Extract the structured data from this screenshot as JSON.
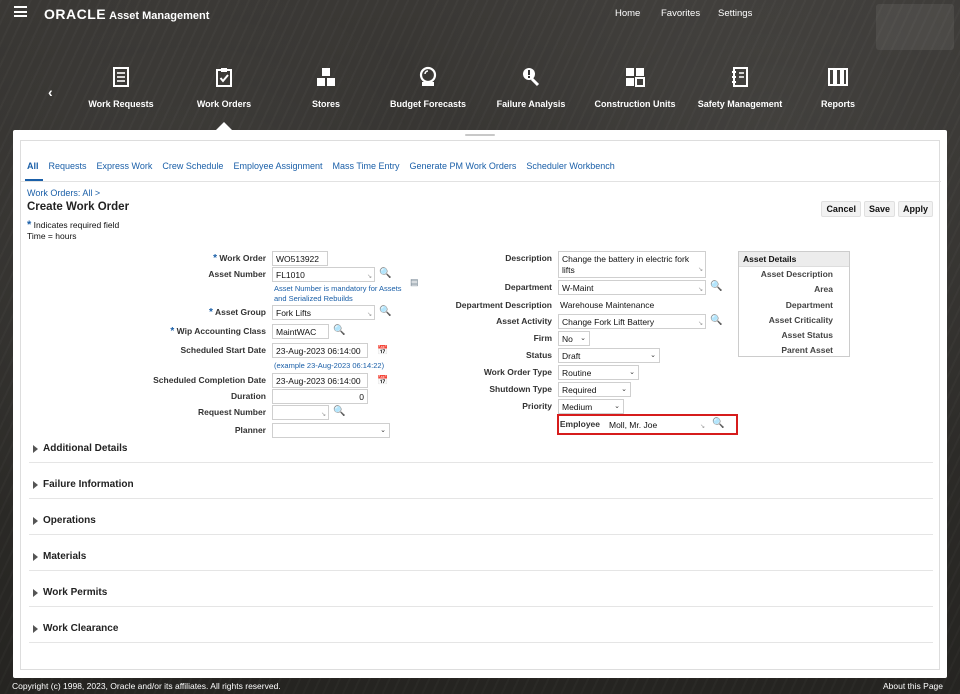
{
  "header": {
    "brand": "ORACLE",
    "app_name": "Asset Management",
    "links": [
      "Home",
      "Favorites",
      "Settings"
    ]
  },
  "nav": {
    "items": [
      {
        "label": "Work Requests",
        "icon": "document-list-icon"
      },
      {
        "label": "Work Orders",
        "icon": "clipboard-check-icon"
      },
      {
        "label": "Stores",
        "icon": "boxes-icon"
      },
      {
        "label": "Budget Forecasts",
        "icon": "crystal-ball-icon"
      },
      {
        "label": "Failure Analysis",
        "icon": "wrench-alert-icon"
      },
      {
        "label": "Construction Units",
        "icon": "puzzle-icon"
      },
      {
        "label": "Safety Management",
        "icon": "binder-icon"
      },
      {
        "label": "Reports",
        "icon": "columns-icon"
      }
    ],
    "active": "Work Orders"
  },
  "tabs": [
    "All",
    "Requests",
    "Express Work",
    "Crew Schedule",
    "Employee Assignment",
    "Mass Time Entry",
    "Generate PM Work Orders",
    "Scheduler Workbench"
  ],
  "breadcrumb": "Work Orders: All  >",
  "page_title": "Create Work Order",
  "required_note": "Indicates required field",
  "time_note": "Time = hours",
  "actions": {
    "cancel": "Cancel",
    "save": "Save",
    "apply": "Apply"
  },
  "form_left": {
    "work_order": {
      "label": "Work Order",
      "value": "WO513922"
    },
    "asset_number": {
      "label": "Asset Number",
      "value": "FL1010",
      "help": "Asset Number is mandatory for Assets and Serialized Rebuilds"
    },
    "asset_group": {
      "label": "Asset Group",
      "value": "Fork Lifts"
    },
    "wip_class": {
      "label": "Wip Accounting Class",
      "value": "MaintWAC"
    },
    "sched_start": {
      "label": "Scheduled Start Date",
      "value": "23-Aug-2023 06:14:00",
      "help": "(example 23-Aug-2023 06:14:22)"
    },
    "sched_completion": {
      "label": "Scheduled Completion Date",
      "value": "23-Aug-2023 06:14:00"
    },
    "duration": {
      "label": "Duration",
      "value": "0"
    },
    "request_number": {
      "label": "Request Number",
      "value": ""
    },
    "planner": {
      "label": "Planner",
      "value": ""
    }
  },
  "form_right": {
    "description": {
      "label": "Description",
      "value": "Change the battery in electric fork lifts"
    },
    "department": {
      "label": "Department",
      "value": "W-Maint"
    },
    "department_desc": {
      "label": "Department Description",
      "value": "Warehouse Maintenance"
    },
    "asset_activity": {
      "label": "Asset Activity",
      "value": "Change Fork Lift Battery"
    },
    "firm": {
      "label": "Firm",
      "value": "No"
    },
    "status": {
      "label": "Status",
      "value": "Draft"
    },
    "wo_type": {
      "label": "Work Order Type",
      "value": "Routine"
    },
    "shutdown_type": {
      "label": "Shutdown Type",
      "value": "Required"
    },
    "priority": {
      "label": "Priority",
      "value": "Medium"
    },
    "employee": {
      "label": "Employee",
      "value": "Moll, Mr. Joe"
    }
  },
  "asset_details": {
    "title": "Asset Details",
    "rows": [
      "Asset Description",
      "Area",
      "Department",
      "Asset Criticality",
      "Asset Status",
      "Parent Asset"
    ]
  },
  "sections": [
    "Additional Details",
    "Failure Information",
    "Operations",
    "Materials",
    "Work Permits",
    "Work Clearance"
  ],
  "footer": {
    "copyright": "Copyright (c) 1998, 2023, Oracle and/or its affiliates. All rights reserved.",
    "about": "About this Page"
  }
}
